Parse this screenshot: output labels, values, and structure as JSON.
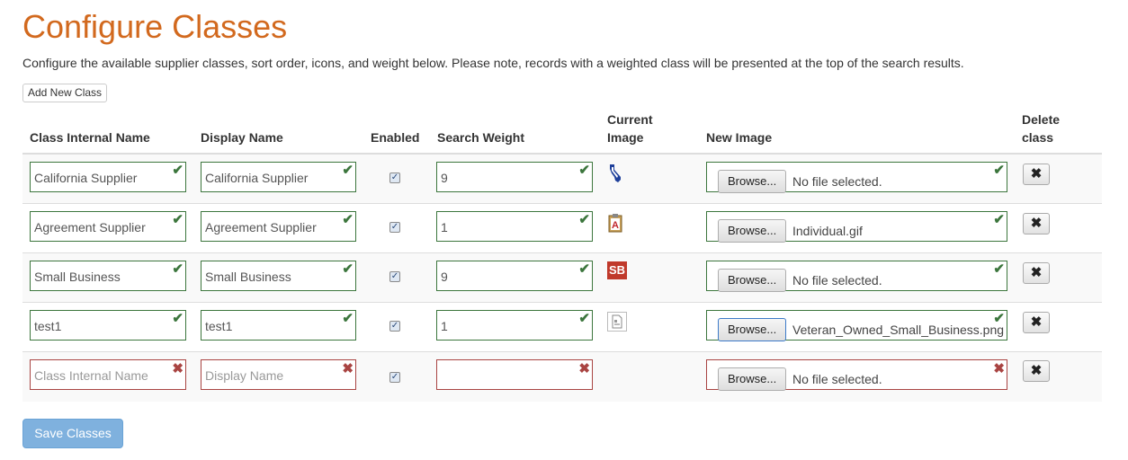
{
  "page": {
    "title": "Configure Classes",
    "description": "Configure the available supplier classes, sort order, icons, and weight below. Please note, records with a weighted class will be presented at the top of the search results."
  },
  "toolbar": {
    "add_label": "Add New Class",
    "save_label": "Save Classes"
  },
  "headers": {
    "internal_name": "Class Internal Name",
    "display_name": "Display Name",
    "enabled": "Enabled",
    "search_weight": "Search Weight",
    "current_image_1": "Current",
    "current_image_2": "Image",
    "new_image": "New Image",
    "delete_1": "Delete",
    "delete_2": "class"
  },
  "rows": [
    {
      "internal_name": "California Supplier",
      "display_name": "California Supplier",
      "enabled": true,
      "weight": "9",
      "icon": "california-state-icon",
      "browse": "Browse...",
      "file": "No file selected.",
      "delete": "✖"
    },
    {
      "internal_name": "Agreement Supplier",
      "display_name": "Agreement Supplier",
      "enabled": true,
      "weight": "1",
      "icon": "clipboard-a-icon",
      "browse": "Browse...",
      "file": "Individual.gif",
      "delete": "✖"
    },
    {
      "internal_name": "Small Business",
      "display_name": "Small Business",
      "enabled": true,
      "weight": "9",
      "icon": "sb-badge-icon",
      "icon_text": "SB",
      "browse": "Browse...",
      "file": "No file selected.",
      "delete": "✖"
    },
    {
      "internal_name": "test1",
      "display_name": "test1",
      "enabled": true,
      "weight": "1",
      "icon": "broken-image-icon",
      "browse": "Browse...",
      "file": "Veteran_Owned_Small_Business.png",
      "delete": "✖"
    },
    {
      "internal_name": "",
      "display_name": "",
      "enabled": true,
      "weight": "",
      "browse": "Browse...",
      "file": "No file selected.",
      "delete": "✖"
    }
  ],
  "placeholders": {
    "internal_name": "Class Internal Name",
    "display_name": "Display Name"
  },
  "marks": {
    "ok": "✔",
    "bad": "✖",
    "checked": "✓"
  },
  "colors": {
    "title": "#d2691e",
    "valid": "#3c763d",
    "invalid": "#a94442",
    "save_button": "#7fb1de"
  }
}
